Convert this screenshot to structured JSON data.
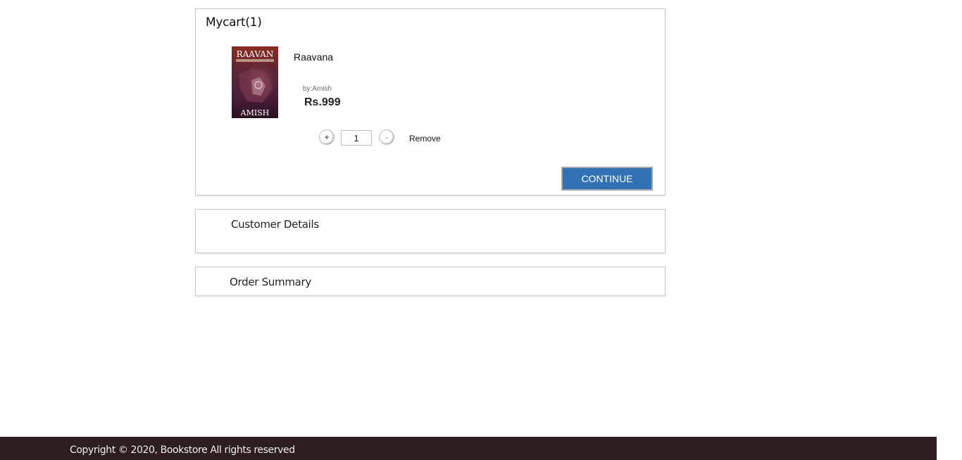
{
  "cart": {
    "title": "Mycart(1)",
    "item": {
      "title": "Raavana",
      "author": "by:Amish",
      "price": "Rs.999",
      "quantity": "1",
      "cover": {
        "title_text": "RAAVAN",
        "author_text": "AMISH"
      }
    },
    "plus_label": "+",
    "minus_label": "-",
    "remove_label": "Remove",
    "continue_label": "CONTINUE"
  },
  "customer_details": {
    "title": "Customer Details"
  },
  "order_summary": {
    "title": "Order Summary"
  },
  "footer": {
    "copyright": "Copyright © 2020, Bookstore All rights reserved"
  },
  "colors": {
    "continue_button": "#3371b5",
    "footer_bg": "#2d1f1f"
  }
}
